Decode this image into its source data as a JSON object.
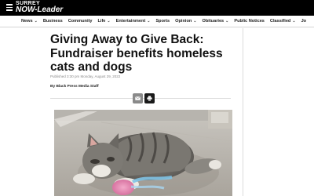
{
  "header": {
    "logo_top": "SURREY",
    "logo_now": "NOW-",
    "logo_leader": "Leader"
  },
  "nav": {
    "items": [
      {
        "label": "News",
        "dropdown": true
      },
      {
        "label": "Business",
        "dropdown": false
      },
      {
        "label": "Community",
        "dropdown": false
      },
      {
        "label": "Life",
        "dropdown": true
      },
      {
        "label": "Entertainment",
        "dropdown": true
      },
      {
        "label": "Sports",
        "dropdown": false
      },
      {
        "label": "Opinion",
        "dropdown": true
      },
      {
        "label": "Obituaries",
        "dropdown": true
      },
      {
        "label": "Public Notices",
        "dropdown": false
      },
      {
        "label": "Classified",
        "dropdown": true
      },
      {
        "label": "Jo",
        "dropdown": false
      }
    ],
    "chevron": "⌄"
  },
  "article": {
    "headline": "Giving Away to Give Back: Fundraiser benefits homeless cats and dogs",
    "published": "Published 3:30 pm Monday, August 29, 2022",
    "author": "By Black Press Media Staff"
  },
  "share": {
    "email_icon": "email-icon",
    "print_icon": "print-icon"
  },
  "colors": {
    "header_bg": "#000000",
    "headline": "#111111"
  }
}
